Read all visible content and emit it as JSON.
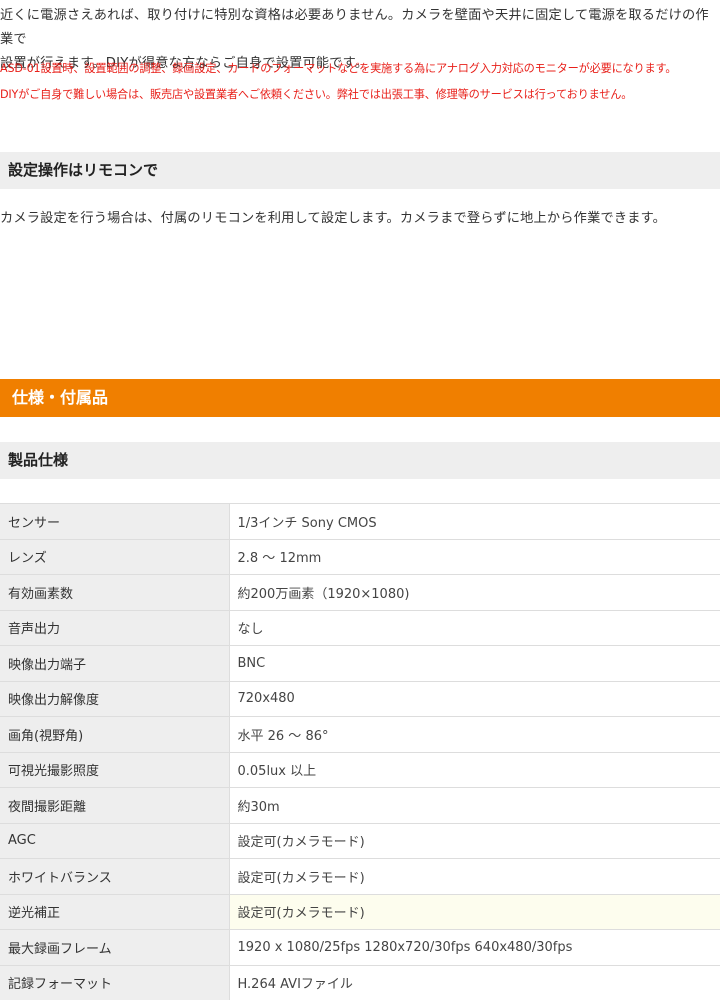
{
  "intro": {
    "line1": "近くに電源さえあれば、取り付けに特別な資格は必要ありません。カメラを壁面や天井に固定して電源を取るだけの作業で",
    "line2": "設置が行えます。DIYが得意な方ならご自身で設置可能です。"
  },
  "warnings": [
    "ASD-01設置時、設置範囲の調整、録画設定、カードのフォーマットなどを実施する為にアナログ入力対応のモニターが必要になります。",
    "DIYがご自身で難しい場合は、販売店や設置業者へご依頼ください。弊社では出張工事、修理等のサービスは行っておりません。"
  ],
  "remote_section": {
    "heading": "設定操作はリモコンで",
    "body": "カメラ設定を行う場合は、付属のリモコンを利用して設定します。カメラまで登らずに地上から作業できます。"
  },
  "spec_section": {
    "title": "仕様・付属品",
    "subheading": "製品仕様",
    "rows": [
      {
        "label": "センサー",
        "value": "1/3インチ Sony CMOS"
      },
      {
        "label": "レンズ",
        "value": "2.8 ～ 12mm"
      },
      {
        "label": "有効画素数",
        "value": "約200万画素（1920×1080)"
      },
      {
        "label": "音声出力",
        "value": "なし"
      },
      {
        "label": "映像出力端子",
        "value": "BNC"
      },
      {
        "label": "映像出力解像度",
        "value": "720x480"
      },
      {
        "label": "画角(視野角)",
        "value": "水平 26 ～ 86°"
      },
      {
        "label": "可視光撮影照度",
        "value": "0.05lux 以上"
      },
      {
        "label": "夜間撮影距離",
        "value": "約30m"
      },
      {
        "label": "AGC",
        "value": "設定可(カメラモード)"
      },
      {
        "label": "ホワイトバランス",
        "value": "設定可(カメラモード)"
      },
      {
        "label": "逆光補正",
        "value": "設定可(カメラモード)"
      },
      {
        "label": "最大録画フレーム",
        "value": "1920 x 1080/25fps 1280x720/30fps 640x480/30fps"
      },
      {
        "label": "記録フォーマット",
        "value": "H.264 AVIファイル"
      }
    ]
  }
}
